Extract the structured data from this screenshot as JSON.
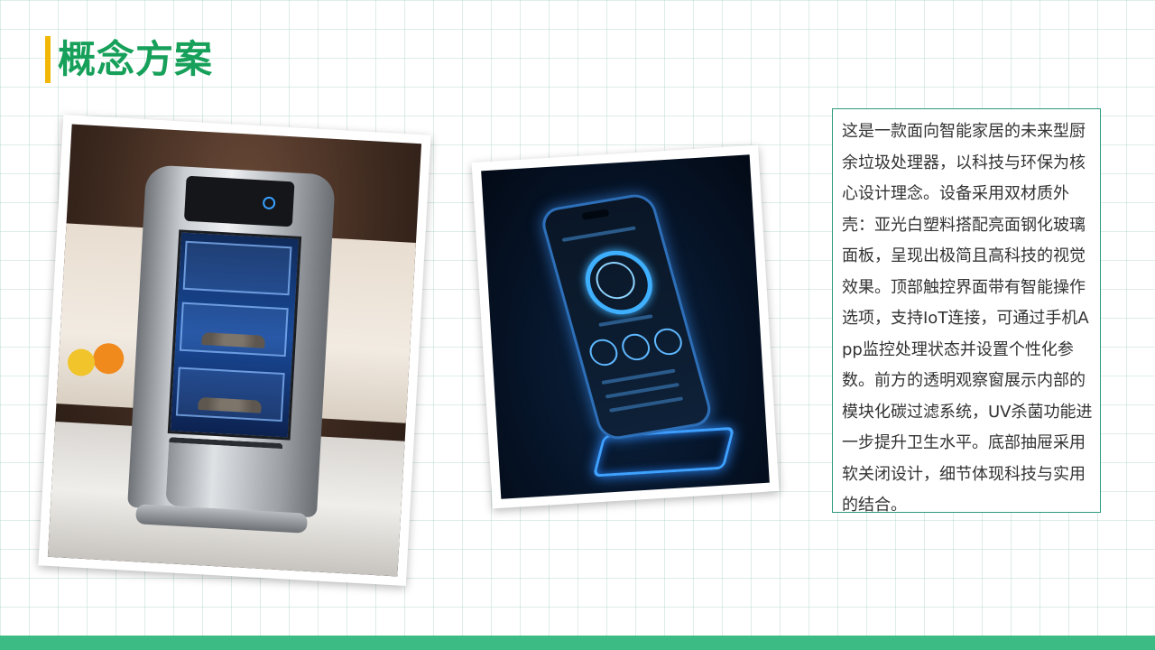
{
  "title": "概念方案",
  "description": "这是一款面向智能家居的未来型厨余垃圾处理器，以科技与环保为核心设计理念。设备采用双材质外壳：亚光白塑料搭配亮面钢化玻璃面板，呈现出极简且高科技的视觉效果。顶部触控界面带有智能操作选项，支持IoT连接，可通过手机App监控处理状态并设置个性化参数。前方的透明观察窗展示内部的模块化碳过滤系统，UV杀菌功能进一步提升卫生水平。底部抽屉采用软关闭设计，细节体现科技与实用的结合。",
  "colors": {
    "title": "#16a05a",
    "accent_bar": "#f2b705",
    "box_border": "#2e9a7c",
    "bottom_bar": "#3dbb84"
  }
}
